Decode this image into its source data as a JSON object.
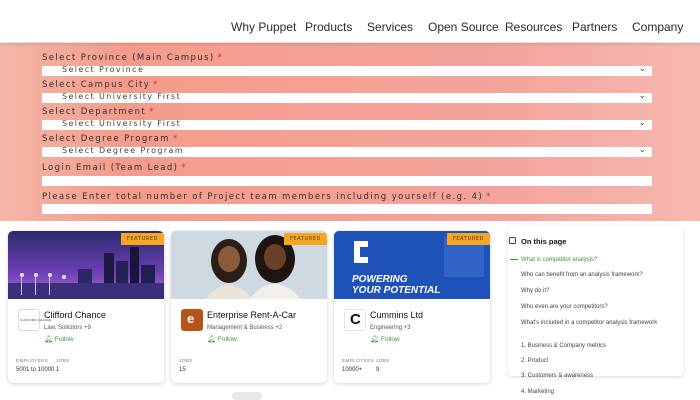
{
  "nav": {
    "items": [
      "Why Puppet",
      "Products",
      "Services",
      "Open Source",
      "Resources",
      "Partners",
      "Company"
    ]
  },
  "form": {
    "fields": [
      {
        "label": "Select Province (Main Campus)",
        "required": "*",
        "value": "Select Province",
        "dropdown": true
      },
      {
        "label": "Select Campus City",
        "required": "*",
        "value": "Select University First",
        "dropdown": true
      },
      {
        "label": "Select Department",
        "required": "*",
        "value": "Select University First",
        "dropdown": true
      },
      {
        "label": "Select Degree Program",
        "required": "*",
        "value": "Select Degree Program",
        "dropdown": true
      },
      {
        "label": "Login Email (Team Lead)",
        "required": "*",
        "value": "",
        "dropdown": false
      },
      {
        "label": "Please Enter total number of Project team members including yourself (e.g. 4)",
        "required": "*",
        "value": "",
        "dropdown": false
      }
    ],
    "gradient": [
      "#f4b6a8",
      "#f39c8a",
      "#f6b8b0"
    ],
    "required_color": "#d6312b"
  },
  "cards": [
    {
      "tag": "FEATURED",
      "name": "Clifford Chance",
      "meta": "Law, Solicitors +9",
      "follow": "Follow",
      "stats": [
        {
          "label": "EMPLOYEES",
          "value": "5001 to 10000"
        },
        {
          "label": "JOBS",
          "value": "1"
        }
      ],
      "logo_text": "CLIFFORD CHANCE"
    },
    {
      "tag": "FEATURED",
      "name": "Enterprise Rent-A-Car",
      "meta": "Management & Business +2",
      "follow": "Follow",
      "stats": [
        {
          "label": "JOBS",
          "value": "15"
        }
      ],
      "logo_text": "e"
    },
    {
      "tag": "FEATURED",
      "name": "Cummins Ltd",
      "meta": "Engineering +3",
      "follow": "Follow",
      "stats": [
        {
          "label": "EMPLOYEES",
          "value": "10000+"
        },
        {
          "label": "JOBS",
          "value": "9"
        }
      ],
      "logo_text": "C",
      "cover_text": [
        "POWERING",
        "YOUR POTENTIAL"
      ]
    }
  ],
  "toc": {
    "title": "On this page",
    "links": [
      "What is competitor analysis?",
      "Who can benefit from an analysis framework?",
      "Why do it?",
      "Who even are your competitors?",
      "What's included in a competitor analysis framework",
      "1. Business & Company metrics",
      "2. Product",
      "3. Customers & awareness",
      "4. Marketing"
    ],
    "active_index": 0,
    "accent": "#2e9b3d"
  }
}
